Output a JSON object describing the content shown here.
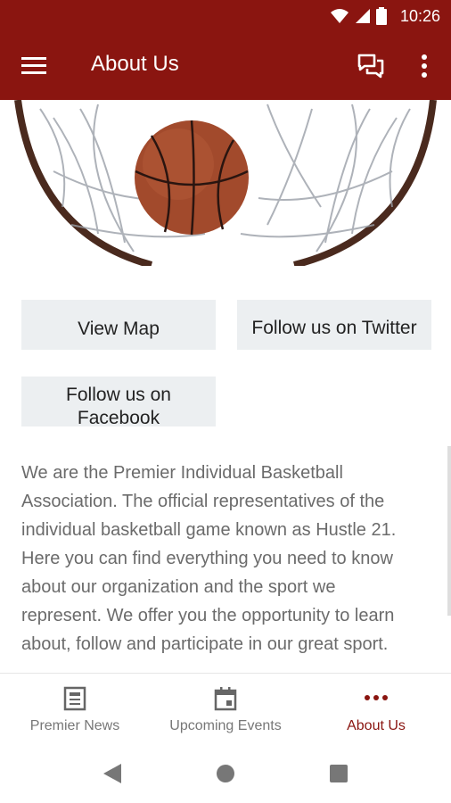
{
  "status": {
    "time": "10:26",
    "icons": [
      "wifi-icon",
      "signal-icon",
      "battery-icon"
    ]
  },
  "appbar": {
    "title": "About Us",
    "icons": [
      "menu-icon",
      "chat-icon",
      "more-vert-icon"
    ]
  },
  "hero": {
    "description_icon": "basketball-hoop-image"
  },
  "buttons": {
    "view_map": "View Map",
    "follow_twitter": "Follow us on Twitter",
    "follow_facebook": "Follow us on Facebook"
  },
  "about_text": "We are the Premier Individual Basketball Association. The official representatives of the individual basketball game known as Hustle 21. Here you can find everything you need to know about our organization and the sport we represent. We offer you the opportunity to learn about, follow and participate in our great sport.",
  "bottom_nav": {
    "items": [
      {
        "label": "Premier News",
        "icon": "news-icon"
      },
      {
        "label": "Upcoming Events",
        "icon": "calendar-icon"
      },
      {
        "label": "About Us",
        "icon": "more-horiz-icon"
      }
    ],
    "active_index": 2
  },
  "colors": {
    "primary": "#8a1510",
    "button_bg": "#eceff1",
    "text_muted": "#6b6b6b"
  }
}
